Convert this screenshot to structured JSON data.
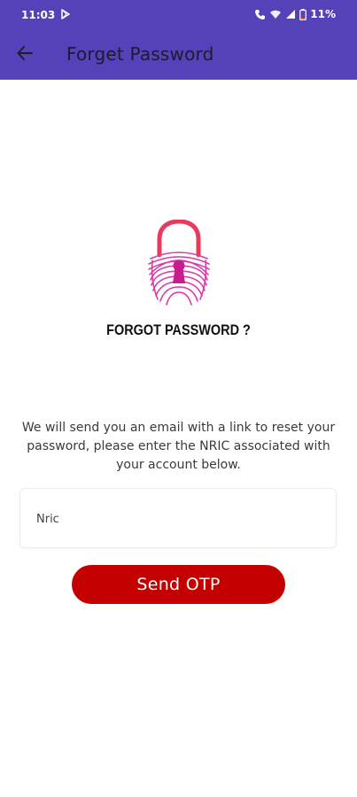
{
  "status_bar": {
    "time": "11:03",
    "battery": "11%"
  },
  "app_bar": {
    "title": "Forget Password",
    "back_icon": "arrow-left-icon"
  },
  "hero": {
    "icon": "fingerprint-padlock-icon",
    "title": "FORGOT PASSWORD ?"
  },
  "description": "We will send you an email with a link to reset your password, please enter the NRIC associated with your account below.",
  "form": {
    "nric_placeholder": "Nric",
    "nric_value": ""
  },
  "actions": {
    "send_otp_label": "Send OTP"
  },
  "colors": {
    "app_bar": "#5542b8",
    "button": "#c40000",
    "lock_shackle": "#e83a5c",
    "fingerprint": "#d93aa8"
  }
}
